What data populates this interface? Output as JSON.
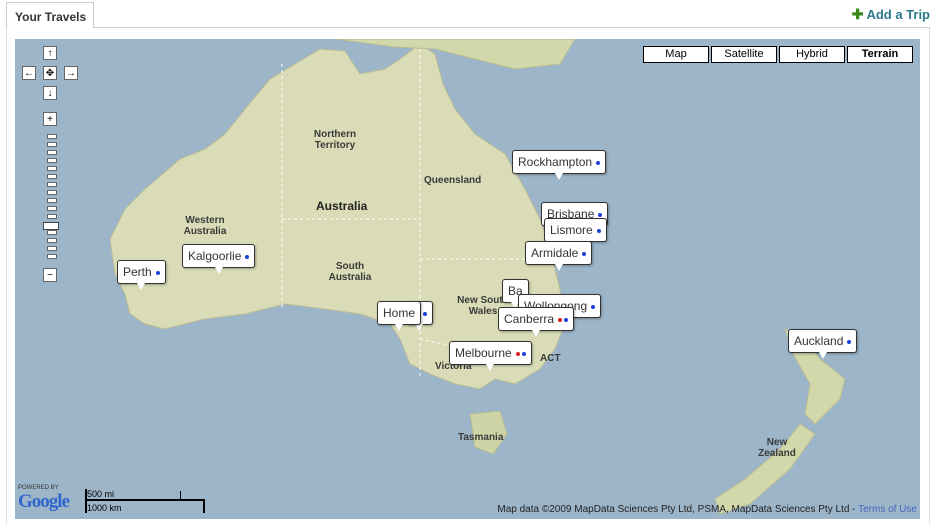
{
  "tab": {
    "label": "Your Travels"
  },
  "add_trip": {
    "label": "Add a Trip"
  },
  "map_types": [
    {
      "label": "Map",
      "selected": false
    },
    {
      "label": "Satellite",
      "selected": false
    },
    {
      "label": "Hybrid",
      "selected": false
    },
    {
      "label": "Terrain",
      "selected": true
    }
  ],
  "nav_controls": {
    "up": "↑",
    "left": "←",
    "center": "✥",
    "right": "→",
    "down": "↓",
    "zoom_in": "+",
    "zoom_out": "−"
  },
  "region_labels": {
    "northern_territory": "Northern Territory",
    "queensland": "Queensland",
    "australia": "Australia",
    "western_australia": "Western Australia",
    "south_australia": "South Australia",
    "new_south_wales": "New South Wales",
    "victoria": "Victoria",
    "act": "ACT",
    "tasmania": "Tasmania",
    "new_zealand": "New Zealand"
  },
  "markers": {
    "rockhampton": "Rockhampton",
    "brisbane": "Brisbane",
    "lismore": "Lismore",
    "armidale": "Armidale",
    "kalgoorlie": "Kalgoorlie",
    "perth": "Perth",
    "home": "Home",
    "home_partial": "e",
    "ba": "Ba",
    "wollongong": "Wollongong",
    "canberra": "Canberra",
    "melbourne": "Melbourne",
    "auckland": "Auckland"
  },
  "colors": {
    "dot_blue": "#1f3fd8",
    "dot_red": "#d82020",
    "water": "#9cb5c9",
    "land": "#d9dcb6"
  },
  "logo": {
    "powered_by": "POWERED BY",
    "brand": "Google"
  },
  "scale": {
    "imperial": "500 mi",
    "metric": "1000 km"
  },
  "copyright": {
    "text": "Map data ©2009 MapData Sciences Pty Ltd, PSMA, MapData Sciences Pty Ltd - ",
    "terms": "Terms of Use"
  }
}
